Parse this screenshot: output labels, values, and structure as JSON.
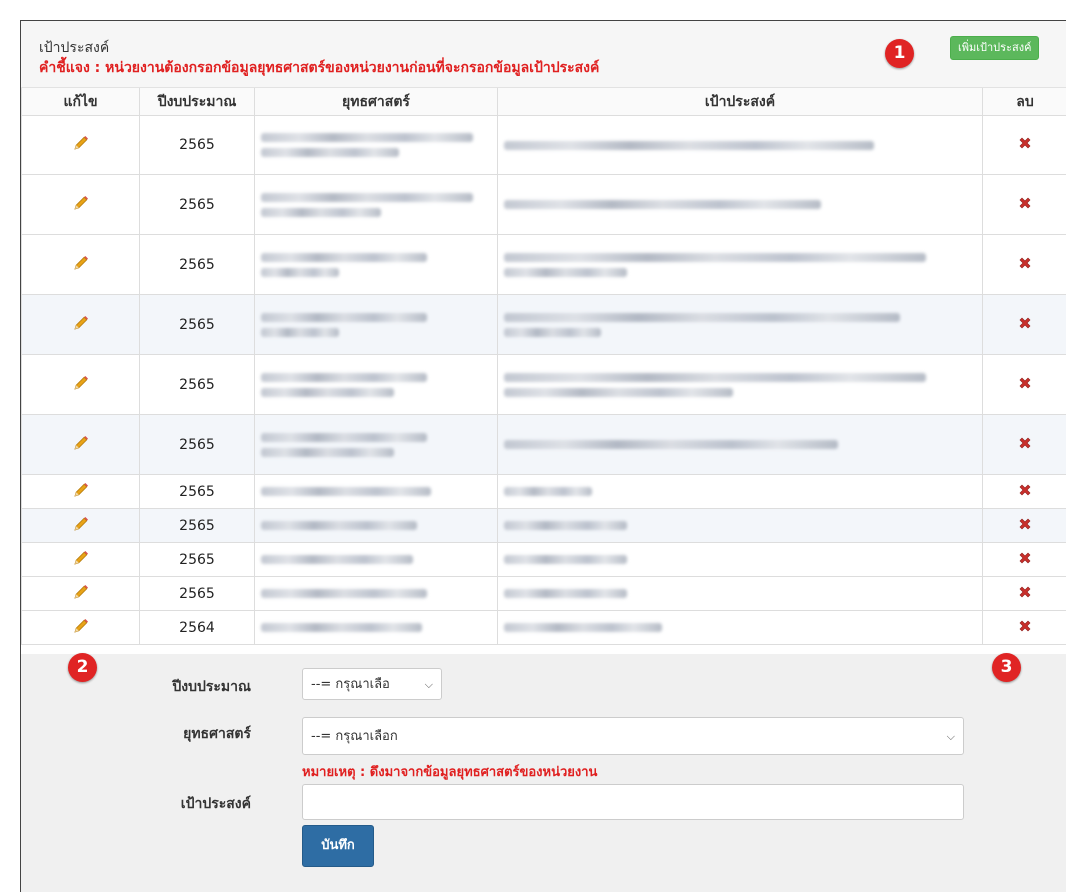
{
  "panel": {
    "title": "เป้าประสงค์",
    "note_label": "คำชี้แจง :",
    "note_text": "หน่วยงานต้องกรอกข้อมูลยุทธศาสตร์ของหน่วยงานก่อนที่จะกรอกข้อมูลเป้าประสงค์",
    "add_button": "เพิ่มเป้าประสงค์"
  },
  "markers": [
    "1",
    "2",
    "3"
  ],
  "table": {
    "headers": [
      "แก้ไข",
      "ปีงบประมาณ",
      "ยุทธศาสตร์",
      "เป้าประสงค์",
      "ลบ"
    ],
    "rows": [
      {
        "year": "2565"
      },
      {
        "year": "2565"
      },
      {
        "year": "2565"
      },
      {
        "year": "2565"
      },
      {
        "year": "2565"
      },
      {
        "year": "2565"
      },
      {
        "year": "2565"
      },
      {
        "year": "2565"
      },
      {
        "year": "2565"
      },
      {
        "year": "2565"
      },
      {
        "year": "2564"
      }
    ]
  },
  "form": {
    "year_label": "ปีงบประมาณ",
    "year_value": "--= กรุณาเลือ",
    "strategy_label": "ยุทธศาสตร์",
    "strategy_value": "--= กรุณาเลือก",
    "remark_label": "หมายเหตุ :",
    "remark_text": "ดึงมาจากข้อมูลยุทธศาสตร์ของหน่วยงาน",
    "goal_label": "เป้าประสงค์",
    "goal_value": "",
    "save_button": "บันทึก"
  },
  "colors": {
    "add_button": "#5cb85c",
    "save_button": "#2e6da4",
    "note_red": "#e02020",
    "marker_red": "#e02424",
    "delete_red": "#c9302c",
    "edit_pencil": "#e8a317"
  },
  "icons": {
    "edit": "pencil-icon",
    "delete": "delete-x-icon",
    "dropdown": "chevron-down-icon"
  }
}
